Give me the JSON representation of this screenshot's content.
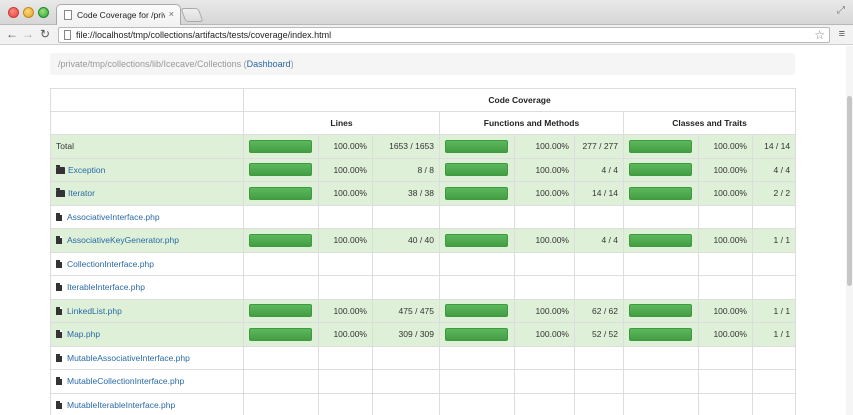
{
  "browser": {
    "tab_title": "Code Coverage for /private/",
    "tab_close": "×",
    "url": "file://localhost/tmp/collections/artifacts/tests/coverage/index.html",
    "back_glyph": "←",
    "forward_glyph": "→",
    "reload_glyph": "↻",
    "star_glyph": "☆",
    "menu_glyph": "≡",
    "resize_glyph": "⤢"
  },
  "breadcrumb": {
    "path": "/private/tmp/collections/lib/Icecave/Collections",
    "open_paren": " (",
    "link": "Dashboard",
    "close_paren": ")"
  },
  "table": {
    "header_main": "Code Coverage",
    "header_lines": "Lines",
    "header_functions": "Functions and Methods",
    "header_classes": "Classes and Traits",
    "rows": [
      {
        "name": "Total",
        "type": "total",
        "covered": true,
        "lines_pct": "100.00%",
        "lines_count": "1653 / 1653",
        "func_pct": "100.00%",
        "func_count": "277 / 277",
        "class_pct": "100.00%",
        "class_count": "14 / 14"
      },
      {
        "name": "Exception",
        "type": "folder",
        "covered": true,
        "lines_pct": "100.00%",
        "lines_count": "8 / 8",
        "func_pct": "100.00%",
        "func_count": "4 / 4",
        "class_pct": "100.00%",
        "class_count": "4 / 4"
      },
      {
        "name": "Iterator",
        "type": "folder",
        "covered": true,
        "lines_pct": "100.00%",
        "lines_count": "38 / 38",
        "func_pct": "100.00%",
        "func_count": "14 / 14",
        "class_pct": "100.00%",
        "class_count": "2 / 2"
      },
      {
        "name": "AssociativeInterface.php",
        "type": "file",
        "covered": false
      },
      {
        "name": "AssociativeKeyGenerator.php",
        "type": "file",
        "covered": true,
        "lines_pct": "100.00%",
        "lines_count": "40 / 40",
        "func_pct": "100.00%",
        "func_count": "4 / 4",
        "class_pct": "100.00%",
        "class_count": "1 / 1"
      },
      {
        "name": "CollectionInterface.php",
        "type": "file",
        "covered": false
      },
      {
        "name": "IterableInterface.php",
        "type": "file",
        "covered": false
      },
      {
        "name": "LinkedList.php",
        "type": "file",
        "covered": true,
        "lines_pct": "100.00%",
        "lines_count": "475 / 475",
        "func_pct": "100.00%",
        "func_count": "62 / 62",
        "class_pct": "100.00%",
        "class_count": "1 / 1"
      },
      {
        "name": "Map.php",
        "type": "file",
        "covered": true,
        "lines_pct": "100.00%",
        "lines_count": "309 / 309",
        "func_pct": "100.00%",
        "func_count": "52 / 52",
        "class_pct": "100.00%",
        "class_count": "1 / 1"
      },
      {
        "name": "MutableAssociativeInterface.php",
        "type": "file",
        "covered": false
      },
      {
        "name": "MutableCollectionInterface.php",
        "type": "file",
        "covered": false
      },
      {
        "name": "MutableIterableInterface.php",
        "type": "file",
        "covered": false
      }
    ]
  },
  "colors": {
    "success_row": "#dff0d8",
    "progress_bar": "#5cb85c",
    "link": "#2a6aa6"
  }
}
